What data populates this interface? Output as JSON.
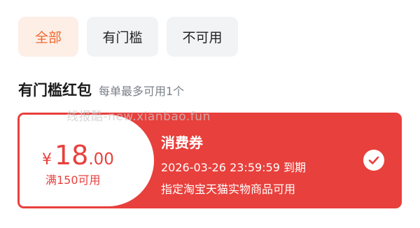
{
  "tabs": [
    {
      "label": "全部",
      "active": true
    },
    {
      "label": "有门槛",
      "active": false
    },
    {
      "label": "不可用",
      "active": false
    }
  ],
  "section": {
    "title": "有门槛红包",
    "subtitle": "每单最多可用1个"
  },
  "watermark": "线报酷-new.xianbao.fun",
  "coupon": {
    "currency": "¥",
    "amount_int": "18",
    "amount_dec": ".00",
    "threshold": "满150可用",
    "title": "消费券",
    "expiry": "2026-03-26 23:59:59 到期",
    "scope": "指定淘宝天猫实物商品可用",
    "selected": true,
    "check_icon": "check-circle-icon"
  },
  "colors": {
    "accent_orange": "#ef6a2e",
    "coupon_red": "#e8403c",
    "tab_bg": "#f2f3f5"
  }
}
